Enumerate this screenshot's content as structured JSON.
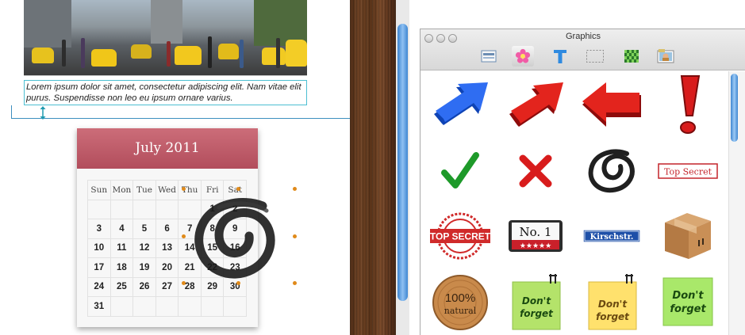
{
  "document": {
    "caption": "Lorem ipsum dolor sit amet, consectetur adipiscing elit. Nam vitae elit purus. Suspendisse non leo eu ipsum ornare varius.",
    "calendar": {
      "title": "July 2011",
      "weekdays": [
        "Sun",
        "Mon",
        "Tue",
        "Wed",
        "Thu",
        "Fri",
        "Sat"
      ],
      "weeks": [
        [
          "",
          "",
          "",
          "",
          "",
          "1",
          "2"
        ],
        [
          "3",
          "4",
          "5",
          "6",
          "7",
          "8",
          "9"
        ],
        [
          "10",
          "11",
          "12",
          "13",
          "14",
          "15",
          "16"
        ],
        [
          "17",
          "18",
          "19",
          "20",
          "21",
          "22",
          "23"
        ],
        [
          "24",
          "25",
          "26",
          "27",
          "28",
          "29",
          "30"
        ],
        [
          "31",
          "",
          "",
          "",
          "",
          "",
          ""
        ]
      ]
    }
  },
  "panel": {
    "title": "Graphics",
    "tabs": [
      {
        "name": "layout-tab",
        "icon": "layout-icon"
      },
      {
        "name": "flower-tab",
        "icon": "flower-icon"
      },
      {
        "name": "text-tab",
        "icon": "text-icon"
      },
      {
        "name": "frame-tab",
        "icon": "dashed-frame-icon"
      },
      {
        "name": "pattern-tab",
        "icon": "checker-pattern-icon"
      },
      {
        "name": "photo-tab",
        "icon": "photo-icon"
      }
    ],
    "items": [
      {
        "name": "blue-arrow-up-right",
        "icon": "blue-arrow-icon"
      },
      {
        "name": "red-arrow-up-right",
        "icon": "red-arrow-icon"
      },
      {
        "name": "red-arrow-left",
        "icon": "red-left-arrow-icon"
      },
      {
        "name": "red-exclamation",
        "icon": "exclamation-icon"
      },
      {
        "name": "green-check",
        "icon": "check-icon"
      },
      {
        "name": "red-cross",
        "icon": "cross-icon"
      },
      {
        "name": "black-scribble-circle",
        "icon": "scribble-circle-icon"
      },
      {
        "name": "top-secret-label",
        "icon": "top-secret-label-icon",
        "text": "Top Secret"
      },
      {
        "name": "top-secret-seal",
        "icon": "top-secret-seal-icon",
        "text": "TOP SECRET"
      },
      {
        "name": "no1-badge",
        "icon": "no1-badge-icon",
        "text": "No. 1",
        "stars": "★★★★★"
      },
      {
        "name": "street-sign",
        "icon": "street-sign-icon",
        "text": "Kirschstr."
      },
      {
        "name": "cardboard-box",
        "icon": "box-icon"
      },
      {
        "name": "natural-badge",
        "icon": "wood-badge-icon",
        "text_big": "100%",
        "text_small": "natural"
      },
      {
        "name": "note-green-clip",
        "icon": "sticky-note-icon",
        "line1": "Don't",
        "line2": "forget"
      },
      {
        "name": "note-yellow-clip",
        "icon": "sticky-note-icon",
        "line1": "Don't",
        "line2": "forget"
      },
      {
        "name": "note-green",
        "icon": "sticky-note-icon",
        "line1": "Don't",
        "line2": "forget"
      }
    ]
  },
  "colors": {
    "calendar_header": "#b8525f",
    "selection_handle": "#e08a1a",
    "scroll_blue": "#3e86d1",
    "guide_line": "#3d8fbf"
  }
}
